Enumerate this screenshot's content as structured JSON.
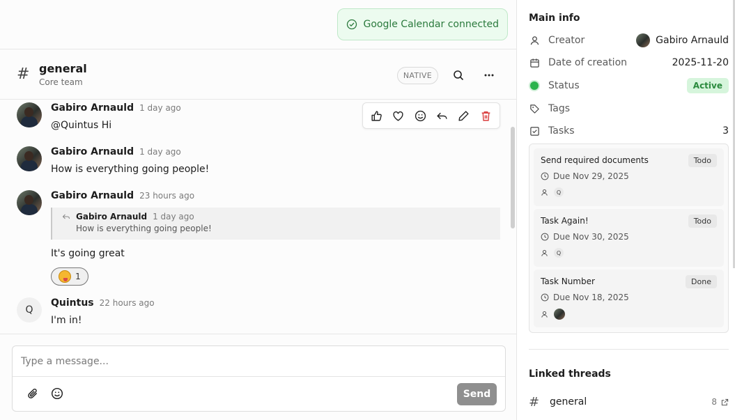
{
  "toast": {
    "text": "Google Calendar connected"
  },
  "channel": {
    "title": "general",
    "subtitle": "Core team",
    "badge": "NATIVE"
  },
  "messages": [
    {
      "author": "Gabiro Arnauld",
      "time": "1 day ago",
      "mention": "@Quintus",
      "text": " Hi"
    },
    {
      "author": "Gabiro Arnauld",
      "time": "1 day ago",
      "text": "How is everything going people!"
    },
    {
      "author": "Gabiro Arnauld",
      "time": "23 hours ago",
      "reply": {
        "author": "Gabiro Arnauld",
        "time": "1 day ago",
        "text": "How is everything going people!"
      },
      "text": "It's going great",
      "reaction_count": "1"
    },
    {
      "author": "Quintus",
      "avatar_letter": "Q",
      "time": "22 hours ago",
      "text": "I'm in!"
    }
  ],
  "composer": {
    "placeholder": "Type a message...",
    "send_label": "Send"
  },
  "panel": {
    "title": "Main info",
    "creator_label": "Creator",
    "creator_value": "Gabiro Arnauld",
    "date_label": "Date of creation",
    "date_value": "2025-11-20",
    "status_label": "Status",
    "status_value": "Active",
    "tags_label": "Tags",
    "tasks_label": "Tasks",
    "tasks_count": "3",
    "tasks": [
      {
        "title": "Send required documents",
        "status": "Todo",
        "due": "Due Nov 29, 2025",
        "assignee": "Q"
      },
      {
        "title": "Task Again!",
        "status": "Todo",
        "due": "Due Nov 30, 2025",
        "assignee": "Q"
      },
      {
        "title": "Task Number",
        "status": "Done",
        "due": "Due Nov 18, 2025",
        "assignee": ""
      }
    ],
    "linked_title": "Linked threads",
    "linked": [
      {
        "name": "general",
        "count": "8"
      }
    ]
  },
  "colors": {
    "accent_green": "#2bb34c",
    "danger": "#d93b3b",
    "send_bg": "#8f8f8f"
  }
}
